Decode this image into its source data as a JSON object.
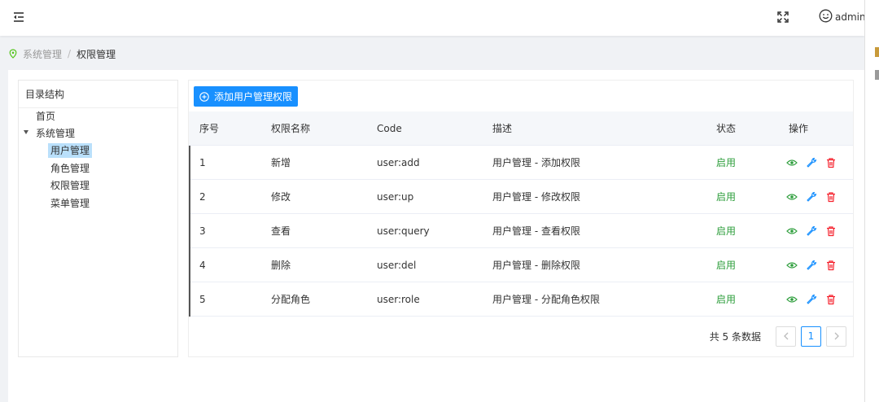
{
  "header": {
    "menu_icon": "menu-fold-icon",
    "fullscreen_icon": "fullscreen-icon",
    "user_icon": "smile-icon",
    "username": "admin"
  },
  "breadcrumb": {
    "icon": "location-icon",
    "items": [
      "系统管理",
      "权限管理"
    ],
    "separator": "/"
  },
  "tree": {
    "title": "目录结构",
    "nodes": [
      {
        "label": "首页"
      },
      {
        "label": "系统管理",
        "expanded": true
      },
      {
        "label": "用户管理",
        "selected": true
      },
      {
        "label": "角色管理"
      },
      {
        "label": "权限管理"
      },
      {
        "label": "菜单管理"
      }
    ]
  },
  "toolbar": {
    "add_label": "添加用户管理权限",
    "add_icon": "plus-circle-icon"
  },
  "table": {
    "columns": [
      "序号",
      "权限名称",
      "Code",
      "描述",
      "状态",
      "操作"
    ],
    "rows": [
      {
        "index": "1",
        "name": "新增",
        "code": "user:add",
        "desc": "用户管理 - 添加权限",
        "status": "启用"
      },
      {
        "index": "2",
        "name": "修改",
        "code": "user:up",
        "desc": "用户管理 - 修改权限",
        "status": "启用"
      },
      {
        "index": "3",
        "name": "查看",
        "code": "user:query",
        "desc": "用户管理 - 查看权限",
        "status": "启用"
      },
      {
        "index": "4",
        "name": "删除",
        "code": "user:del",
        "desc": "用户管理 - 删除权限",
        "status": "启用"
      },
      {
        "index": "5",
        "name": "分配角色",
        "code": "user:role",
        "desc": "用户管理 - 分配角色权限",
        "status": "启用"
      }
    ],
    "row_actions": [
      "eye-icon",
      "wrench-icon",
      "trash-icon"
    ]
  },
  "pagination": {
    "total_text": "共 5 条数据",
    "current_page": "1",
    "prev_icon": "chevron-left-icon",
    "next_icon": "chevron-right-icon"
  },
  "colors": {
    "primary": "#1890ff",
    "status_enabled": "#2e9e3c",
    "delete": "#f5222d",
    "view": "#2e9e3c"
  }
}
